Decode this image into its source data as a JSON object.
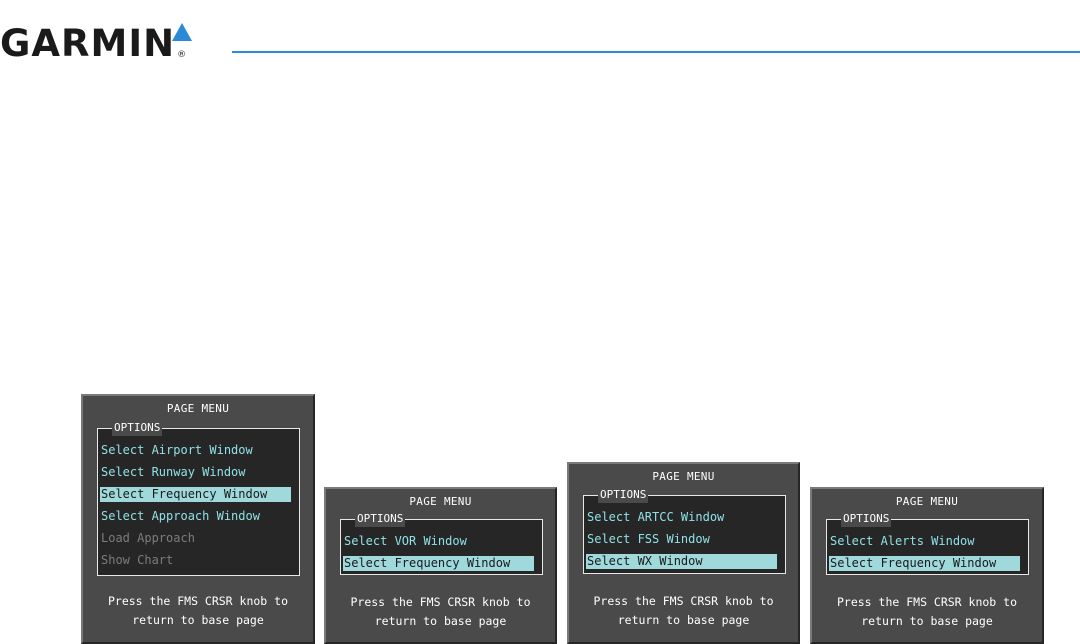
{
  "logo": {
    "text": "GARMIN",
    "reg": "®"
  },
  "colors": {
    "accent": "#2a8ad6",
    "item_text": "#8fe0e6",
    "selected_bg": "#9fd9dc",
    "panel_bg": "#4a4a4a"
  },
  "panels": [
    {
      "title": "PAGE MENU",
      "options_label": "OPTIONS",
      "items": [
        {
          "label": "Select Airport Window",
          "state": "normal"
        },
        {
          "label": "Select Runway Window",
          "state": "normal"
        },
        {
          "label": "Select Frequency Window",
          "state": "selected"
        },
        {
          "label": "Select Approach Window",
          "state": "normal"
        },
        {
          "label": "Load Approach",
          "state": "disabled"
        },
        {
          "label": "Show Chart",
          "state": "disabled"
        }
      ],
      "footer_line1": "Press the FMS CRSR knob to",
      "footer_line2": "return to base page"
    },
    {
      "title": "PAGE MENU",
      "options_label": "OPTIONS",
      "items": [
        {
          "label": "Select VOR Window",
          "state": "normal"
        },
        {
          "label": "Select Frequency Window",
          "state": "selected"
        }
      ],
      "footer_line1": "Press the FMS CRSR knob to",
      "footer_line2": "return to base page"
    },
    {
      "title": "PAGE MENU",
      "options_label": "OPTIONS",
      "items": [
        {
          "label": "Select ARTCC Window",
          "state": "normal"
        },
        {
          "label": "Select FSS Window",
          "state": "normal"
        },
        {
          "label": "Select WX Window",
          "state": "selected"
        }
      ],
      "footer_line1": "Press the FMS CRSR knob to",
      "footer_line2": "return to base page"
    },
    {
      "title": "PAGE MENU",
      "options_label": "OPTIONS",
      "items": [
        {
          "label": "Select Alerts Window",
          "state": "normal"
        },
        {
          "label": "Select Frequency Window",
          "state": "selected"
        }
      ],
      "footer_line1": "Press the FMS CRSR knob to",
      "footer_line2": "return to base page"
    }
  ]
}
